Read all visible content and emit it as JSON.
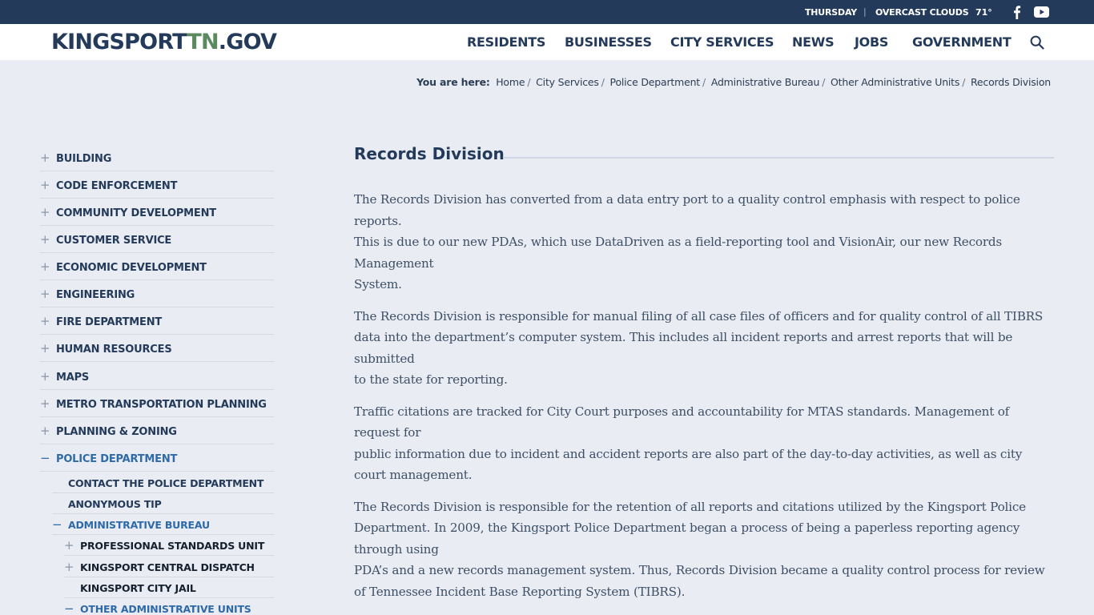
{
  "topbar": {
    "day": "THURSDAY",
    "separator": "|",
    "weather": "OVERCAST CLOUDS",
    "temperature": "71°",
    "social": [
      "facebook-icon",
      "youtube-icon"
    ]
  },
  "header": {
    "logo_part1": "KINGSPORT",
    "logo_part2": "TN",
    "logo_part3": ".GOV",
    "nav": [
      "RESIDENTS",
      "BUSINESSES",
      "CITY SERVICES",
      "NEWS",
      "JOBS",
      "GOVERNMENT"
    ],
    "search_icon": "search-icon"
  },
  "breadcrumb": {
    "label": "You are here:",
    "items": [
      "Home",
      "City Services",
      "Police Department",
      "Administrative Bureau",
      "Other Administrative Units",
      "Records Division"
    ]
  },
  "sidebar": {
    "items": [
      {
        "label": "BUILDING"
      },
      {
        "label": "CODE ENFORCEMENT"
      },
      {
        "label": "COMMUNITY DEVELOPMENT"
      },
      {
        "label": "CUSTOMER SERVICE"
      },
      {
        "label": "ECONOMIC DEVELOPMENT"
      },
      {
        "label": "ENGINEERING"
      },
      {
        "label": "FIRE DEPARTMENT"
      },
      {
        "label": "HUMAN RESOURCES"
      },
      {
        "label": "MAPS"
      },
      {
        "label": "METRO TRANSPORTATION PLANNING"
      },
      {
        "label": "PLANNING & ZONING"
      },
      {
        "label": "POLICE DEPARTMENT"
      }
    ],
    "police_sub": [
      {
        "label": "CONTACT THE POLICE DEPARTMENT"
      },
      {
        "label": "ANONYMOUS TIP"
      },
      {
        "label": "ADMINISTRATIVE BUREAU"
      }
    ],
    "admin_sub": [
      {
        "label": "PROFESSIONAL STANDARDS UNIT"
      },
      {
        "label": "KINGSPORT CENTRAL DISPATCH"
      },
      {
        "label": "KINGSPORT CITY JAIL"
      },
      {
        "label": "OTHER ADMINISTRATIVE UNITS"
      }
    ]
  },
  "main": {
    "title": "Records Division",
    "paragraphs": [
      [
        "The Records Division has converted from a data entry port to a quality control emphasis with respect to police reports.",
        "This is due to our new PDAs, which use DataDriven as a field-reporting tool and VisionAir, our new Records Management",
        "System."
      ],
      [
        "The Records Division is responsible for manual filing of all case files of officers and for quality control of all TIBRS data into the department’s computer system. This includes all incident reports and arrest reports that will be submitted",
        "to the state for reporting."
      ],
      [
        "Traffic citations are tracked for City Court purposes and accountability for MTAS standards. Management of request for",
        "public information due to incident and accident reports are also part of the day-to-day activities, as well as city court management."
      ],
      [
        "The Records Division is responsible for the retention of all reports and citations utilized by the Kingsport Police Department. In 2009, the Kingsport Police Department began a process of being a paperless reporting agency through using",
        "PDA’s and a new records management system. Thus, Records Division became a quality control process for review of Tennessee Incident Base Reporting System (TIBRS)."
      ]
    ]
  },
  "colors": {
    "topbar": "#243a5a",
    "brand_navy": "#243a5a",
    "brand_green": "#5a8a5e",
    "active_link": "#2f6aa8",
    "background": "#e9ecf2"
  }
}
